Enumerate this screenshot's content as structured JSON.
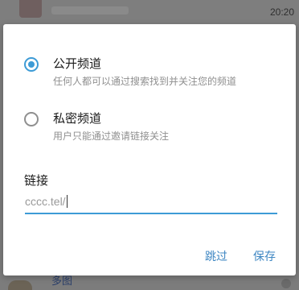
{
  "background": {
    "time": "20:20",
    "bottom_text": "多图"
  },
  "dialog": {
    "options": [
      {
        "title": "公开频道",
        "description": "任何人都可以通过搜索找到并关注您的频道",
        "selected": true
      },
      {
        "title": "私密频道",
        "description": "用户只能通过邀请链接关注",
        "selected": false
      }
    ],
    "link": {
      "label": "链接",
      "value": "cccc.tel/"
    },
    "buttons": {
      "skip": "跳过",
      "save": "保存"
    }
  },
  "colors": {
    "accent": "#3d9bd6",
    "button_text": "#3d86c2",
    "overlay": "#7c7c7c"
  }
}
